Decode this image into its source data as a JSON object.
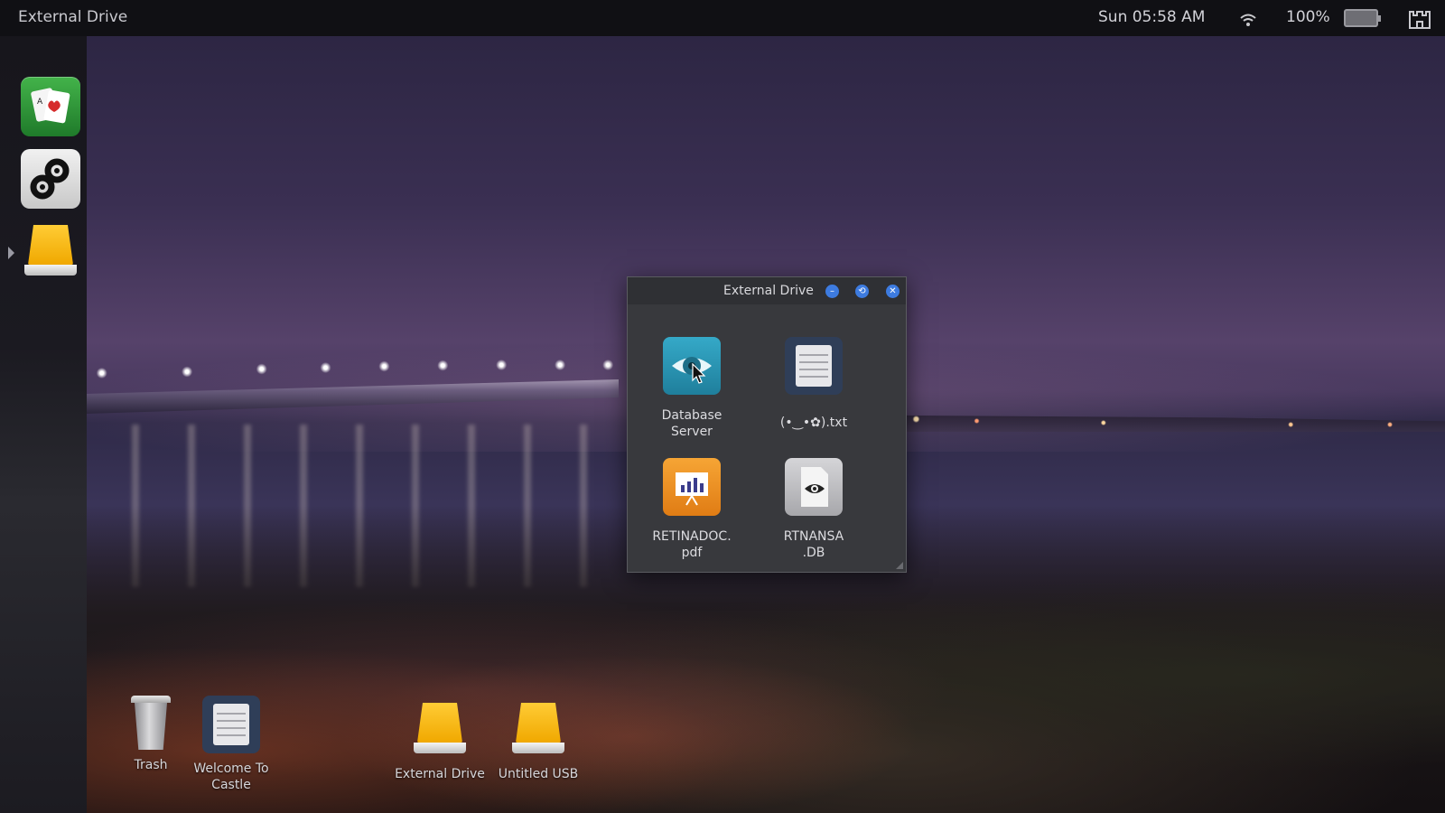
{
  "topbar": {
    "title": "External Drive",
    "clock": "Sun 05:58 AM",
    "battery_percent": "100%",
    "icons": [
      "wifi-icon",
      "battery-icon",
      "castle-icon"
    ]
  },
  "dock": {
    "items": [
      {
        "name": "solitaire-app",
        "icon": "playing-cards-icon"
      },
      {
        "name": "settings-app",
        "icon": "gears-icon"
      },
      {
        "name": "external-drive",
        "icon": "drive-icon",
        "active": true
      }
    ]
  },
  "window": {
    "title": "External Drive",
    "buttons": {
      "minimize": "–",
      "maximize": "⟲",
      "close": "✕"
    },
    "files": [
      {
        "label": "Database\nServer",
        "icon": "eye-icon"
      },
      {
        "label": "(•‿•✿).txt",
        "icon": "text-document-icon"
      },
      {
        "label": "RETINADOC.\npdf",
        "icon": "presentation-chart-icon"
      },
      {
        "label": "RTNANSA\n.DB",
        "icon": "eye-document-icon"
      }
    ]
  },
  "desktop": {
    "items": [
      {
        "label": "Trash",
        "icon": "trash-icon"
      },
      {
        "label": "Welcome To\nCastle",
        "icon": "text-document-icon"
      },
      {
        "label": "External Drive",
        "icon": "drive-icon"
      },
      {
        "label": "Untitled USB",
        "icon": "drive-icon"
      }
    ]
  },
  "colors": {
    "window_bg": "#38393d",
    "titlebar_bg": "#2f3034",
    "window_button": "#3d7be0",
    "drive_yellow": "#f0a800",
    "db_teal": "#2596b4",
    "pdf_orange": "#e98a1e"
  }
}
